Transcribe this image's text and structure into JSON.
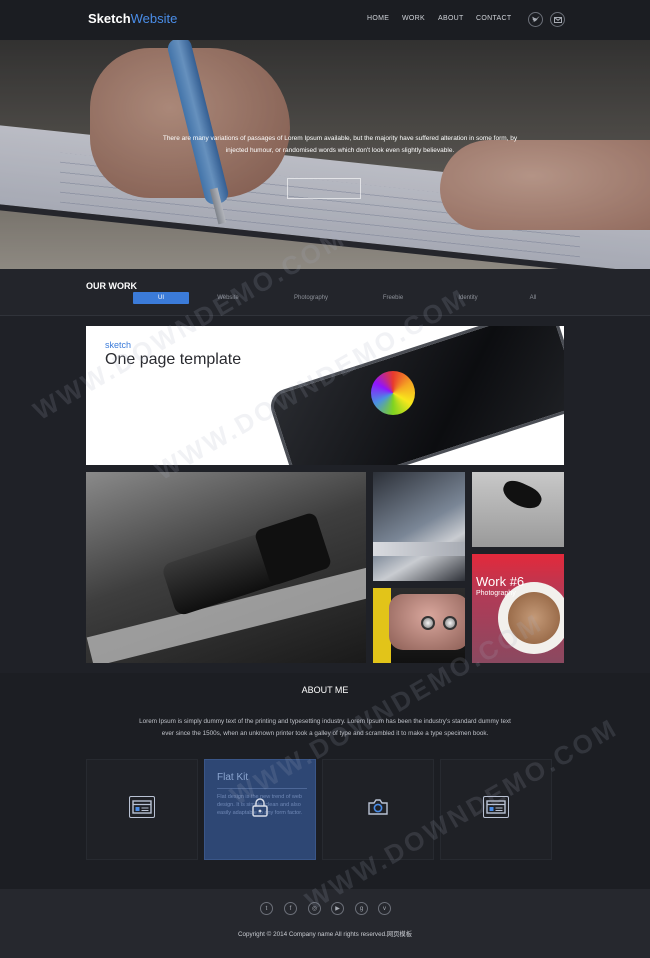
{
  "header": {
    "logo_bold": "Sketch",
    "logo_light": "Website",
    "nav": [
      "HOME",
      "WORK",
      "ABOUT",
      "CONTACT"
    ],
    "social_icons": [
      "twitter-icon",
      "mail-icon"
    ]
  },
  "hero": {
    "line1": "There are many variations of passages of Lorem Ipsum available, but the majority have suffered alteration in some form, by",
    "line2": "injected humour, or randomised words which don't look even slightly believable."
  },
  "work": {
    "title": "OUR WORK",
    "filters": [
      "UI",
      "Website",
      "Photography",
      "Freebie",
      "Identity",
      "All"
    ],
    "active_filter": "UI",
    "banner_brand": "sketch",
    "banner_title": "One page template",
    "tile_title": "Work #6",
    "tile_category": "Photography"
  },
  "about": {
    "title": "ABOUT ME",
    "text_line1": "Lorem Ipsum is simply dummy text of the printing and typesetting industry. Lorem Ipsum has been the industry's standard dummy text",
    "text_line2": "ever since the 1500s, when an unknown printer took a galley of type and scrambled it to make a type specimen book.",
    "features": [
      {
        "icon": "browser-icon"
      },
      {
        "icon": "lock-icon",
        "title": "Flat Kit",
        "desc": "Flat design is the new trend of web design. It is simple, clean and also easily adaptable to any form factor."
      },
      {
        "icon": "camera-icon"
      },
      {
        "icon": "browser-icon"
      }
    ]
  },
  "footer": {
    "social_icons": [
      "twitter-icon",
      "facebook-icon",
      "dribbble-icon",
      "youtube-icon",
      "google-plus-icon",
      "vimeo-icon"
    ],
    "copyright": "Copyright © 2014 Company name All rights reserved.网页模板"
  },
  "watermark": "WWW.DOWNDEMO.COM",
  "colors": {
    "accent": "#3b7bd9",
    "background": "#1f2127",
    "feature_active": "#2e4774"
  }
}
